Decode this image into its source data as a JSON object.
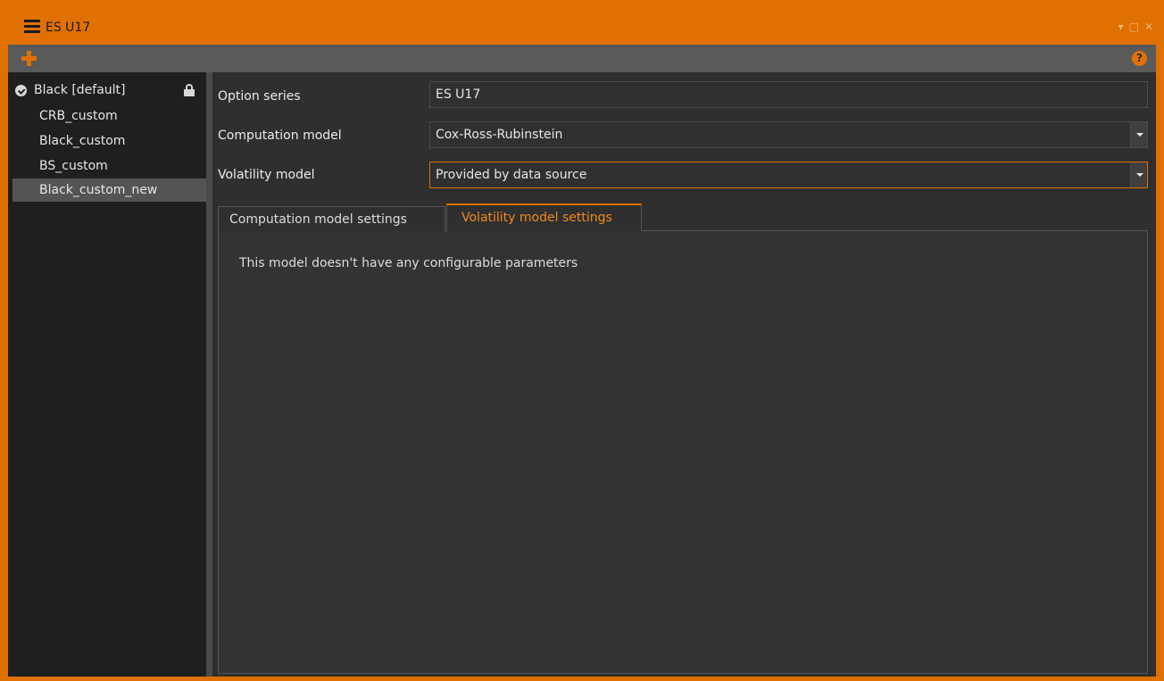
{
  "window": {
    "title": "ES U17",
    "controls": [
      "▾",
      "□",
      "✕"
    ],
    "accent_color": "#e07000"
  },
  "toolbar": {
    "add_icon": "plus-icon",
    "help_icon": "help-icon",
    "help_glyph": "?"
  },
  "sidebar": {
    "items": [
      {
        "label": "Black [default]",
        "default": true,
        "locked": true
      },
      {
        "label": "CRB_custom"
      },
      {
        "label": "Black_custom"
      },
      {
        "label": "BS_custom"
      },
      {
        "label": "Black_custom_new",
        "selected": true
      }
    ]
  },
  "form": {
    "option_series_label": "Option series",
    "option_series_value": "ES U17",
    "computation_model_label": "Computation model",
    "computation_model_value": "Cox-Ross-Rubinstein",
    "volatility_model_label": "Volatility model",
    "volatility_model_value": "Provided by data source"
  },
  "tabs": {
    "computation": "Computation model settings",
    "volatility": "Volatility model settings",
    "active": "volatility"
  },
  "panel": {
    "message": "This model doesn't have any configurable parameters"
  }
}
